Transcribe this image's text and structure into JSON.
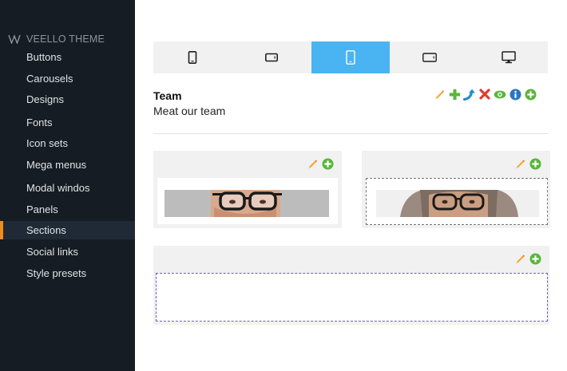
{
  "sidebar": {
    "brand": "VEELLO THEME",
    "items": [
      {
        "label": "Buttons"
      },
      {
        "label": "Carousels"
      },
      {
        "label": "Designs"
      },
      {
        "label": "Fonts"
      },
      {
        "label": "Icon sets"
      },
      {
        "label": "Mega menus"
      },
      {
        "label": "Modal windos"
      },
      {
        "label": "Panels"
      },
      {
        "label": "Sections",
        "active": true
      },
      {
        "label": "Social links"
      },
      {
        "label": "Style presets"
      }
    ],
    "accent": "#f08c1c",
    "background": "#161c24"
  },
  "devices": {
    "items": [
      "phone-portrait-icon",
      "phone-landscape-icon",
      "tablet-portrait-icon",
      "tablet-landscape-icon",
      "desktop-icon"
    ],
    "active_index": 2,
    "active_color": "#4ab3f2"
  },
  "section": {
    "title": "Team",
    "subtitle": "Meat our team",
    "tools": [
      "edit-icon",
      "add-icon",
      "move-icon",
      "delete-icon",
      "visibility-icon",
      "info-icon",
      "add-circle-icon"
    ]
  },
  "colors": {
    "edit": "#f4a731",
    "add": "#5ab53a",
    "move": "#1e8fc8",
    "delete": "#e03b2e",
    "info": "#2a76c3",
    "selection_dashed": "#6a57e0"
  }
}
